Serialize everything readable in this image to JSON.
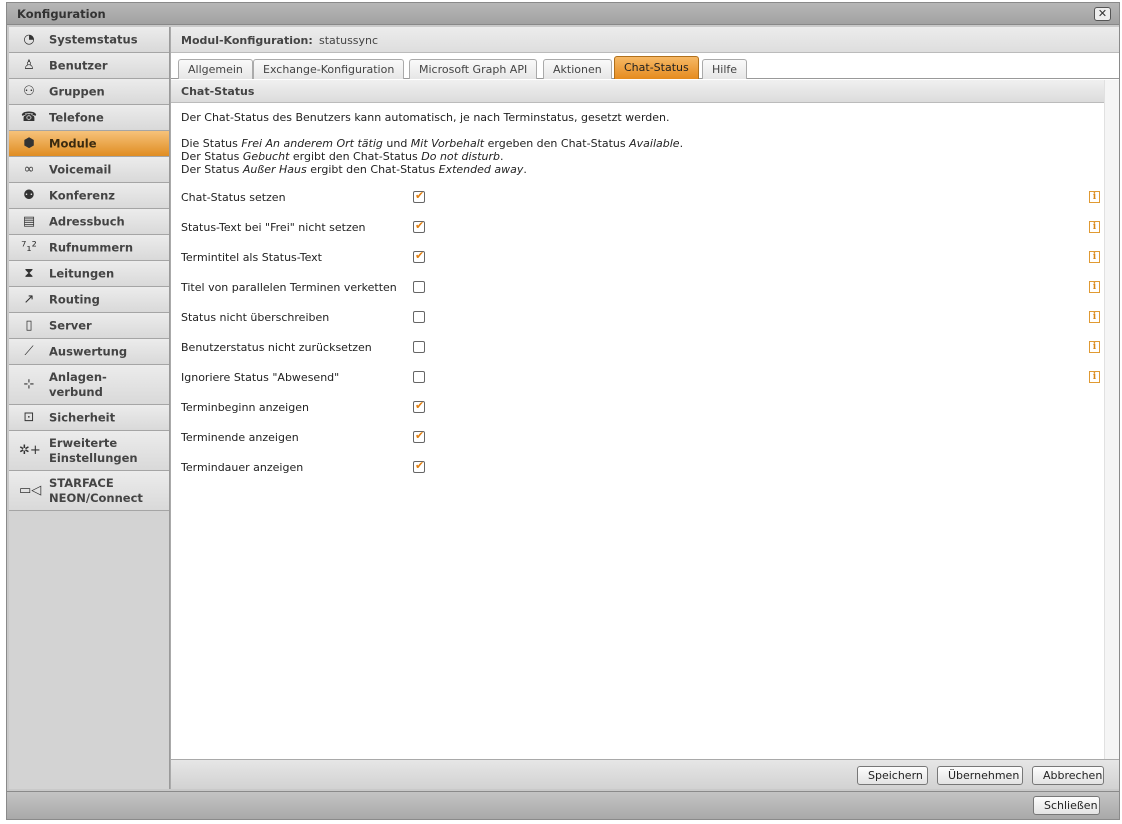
{
  "window": {
    "title": "Konfiguration"
  },
  "sidebar": {
    "items": [
      {
        "label": "Systemstatus",
        "icon": "clock-icon"
      },
      {
        "label": "Benutzer",
        "icon": "user-icon"
      },
      {
        "label": "Gruppen",
        "icon": "group-icon"
      },
      {
        "label": "Telefone",
        "icon": "phone-icon"
      },
      {
        "label": "Module",
        "icon": "cube-icon",
        "active": true
      },
      {
        "label": "Voicemail",
        "icon": "voicemail-icon"
      },
      {
        "label": "Konferenz",
        "icon": "conference-icon"
      },
      {
        "label": "Adressbuch",
        "icon": "addressbook-icon"
      },
      {
        "label": "Rufnummern",
        "icon": "numbers-icon"
      },
      {
        "label": "Leitungen",
        "icon": "plug-icon"
      },
      {
        "label": "Routing",
        "icon": "routing-icon"
      },
      {
        "label": "Server",
        "icon": "server-icon"
      },
      {
        "label": "Auswertung",
        "icon": "chart-icon"
      },
      {
        "label": "Anlagen-\nverbund",
        "icon": "network-icon"
      },
      {
        "label": "Sicherheit",
        "icon": "lock-icon"
      },
      {
        "label": "Erweiterte\nEinstellungen",
        "icon": "gear-plus-icon"
      },
      {
        "label": "STARFACE\nNEON/Connect",
        "icon": "camera-icon"
      }
    ]
  },
  "header": {
    "label": "Modul-Konfiguration:",
    "value": "statussync"
  },
  "tabs": [
    {
      "label": "Allgemein"
    },
    {
      "label": "Exchange-Konfiguration"
    },
    {
      "label": "Microsoft Graph API"
    },
    {
      "label": "Aktionen"
    },
    {
      "label": "Chat-Status",
      "active": true
    },
    {
      "label": "Hilfe"
    }
  ],
  "section": {
    "title": "Chat-Status",
    "intro": "Der Chat-Status des Benutzers kann automatisch, je nach Terminstatus, gesetzt werden.",
    "lines": {
      "l1_a": "Die Status ",
      "l1_b": "Frei An anderem Ort tätig",
      "l1_c": " und ",
      "l1_d": "Mit Vorbehalt",
      "l1_e": " ergeben den Chat-Status ",
      "l1_f": "Available",
      "l1_g": ".",
      "l2_a": "Der Status ",
      "l2_b": "Gebucht",
      "l2_c": " ergibt den Chat-Status ",
      "l2_d": "Do not disturb",
      "l2_e": ".",
      "l3_a": "Der Status ",
      "l3_b": "Außer Haus",
      "l3_c": " ergibt den Chat-Status ",
      "l3_d": "Extended away",
      "l3_e": "."
    }
  },
  "options": [
    {
      "label": "Chat-Status setzen",
      "checked": true,
      "info": true
    },
    {
      "label": "Status-Text bei \"Frei\" nicht setzen",
      "checked": true,
      "info": true
    },
    {
      "label": "Termintitel als Status-Text",
      "checked": true,
      "info": true
    },
    {
      "label": "Titel von parallelen Terminen verketten",
      "checked": false,
      "info": true
    },
    {
      "label": "Status nicht überschreiben",
      "checked": false,
      "info": true
    },
    {
      "label": "Benutzerstatus nicht zurücksetzen",
      "checked": false,
      "info": true
    },
    {
      "label": "Ignoriere Status \"Abwesend\"",
      "checked": false,
      "info": true
    },
    {
      "label": "Terminbeginn anzeigen",
      "checked": true,
      "info": false
    },
    {
      "label": "Terminende anzeigen",
      "checked": true,
      "info": false
    },
    {
      "label": "Termindauer anzeigen",
      "checked": true,
      "info": false
    }
  ],
  "buttons": {
    "save": "Speichern",
    "apply": "Übernehmen",
    "cancel": "Abbrechen",
    "close": "Schließen"
  },
  "colors": {
    "accent": "#e58b1e",
    "checkmark": "#e07f10"
  }
}
